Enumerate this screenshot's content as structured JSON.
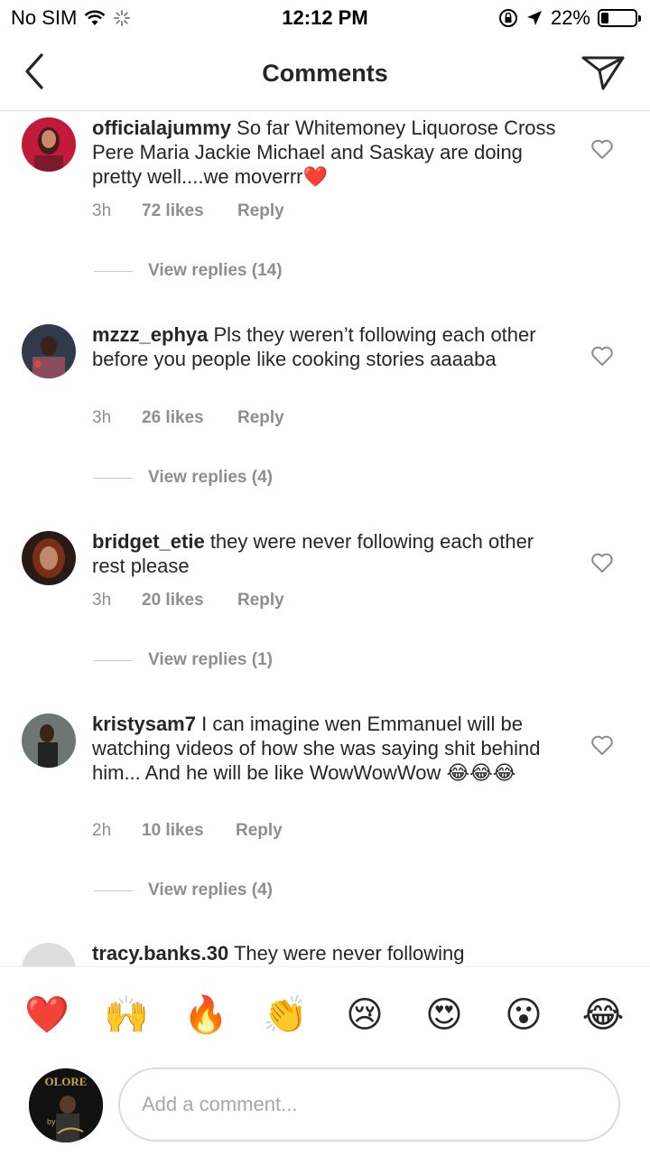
{
  "status": {
    "carrier": "No SIM",
    "time": "12:12 PM",
    "battery": "22%",
    "battery_level": 0.22
  },
  "nav": {
    "title": "Comments"
  },
  "comments": [
    {
      "user": "officialajummy",
      "text": " So far Whitemoney Liquorose Cross Pere Maria Jackie Michael and Saskay are doing pretty well....we moverrr❤️",
      "time": "3h",
      "likes": "72 likes",
      "reply": "Reply",
      "view_replies": "View replies (14)",
      "avatar_color": "#c21a3a"
    },
    {
      "user": "mzzz_ephya",
      "text": " Pls they weren’t following each other before you people like cooking stories aaaaba",
      "time": "3h",
      "likes": "26 likes",
      "reply": "Reply",
      "view_replies": "View replies (4)",
      "avatar_color": "#8a4b5c"
    },
    {
      "user": "bridget_etie",
      "text": " they were never following each other rest please",
      "time": "3h",
      "likes": "20 likes",
      "reply": "Reply",
      "view_replies": "View replies (1)",
      "avatar_color": "#7a2e1a"
    },
    {
      "user": "kristysam7",
      "text": " I can imagine wen Emmanuel will be watching videos of how she was saying shit behind him... And he will be like WowWowWow 😂😂😂",
      "time": "2h",
      "likes": "10 likes",
      "reply": "Reply",
      "view_replies": "View replies (4)",
      "avatar_color": "#6d7672"
    },
    {
      "user": "tracy.banks.30",
      "text": " They were never following",
      "avatar_color": "#dddddd"
    }
  ],
  "emojis": [
    "❤️",
    "🙌",
    "🔥",
    "👏",
    "😢",
    "😍",
    "😮",
    "😂"
  ],
  "composer": {
    "placeholder": "Add a comment...",
    "avatar_text": "OLORE",
    "avatar_sub": "by"
  }
}
